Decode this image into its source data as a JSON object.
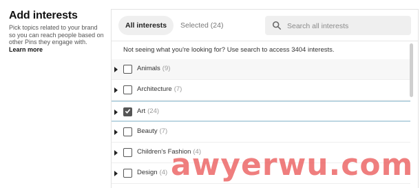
{
  "intro": {
    "title": "Add interests",
    "description": "Pick topics related to your brand so you can reach people based on other Pins they engage with.",
    "link": "Learn more"
  },
  "tabs": {
    "all": "All interests",
    "selected": "Selected (24)"
  },
  "search": {
    "placeholder": "Search all interests",
    "value": ""
  },
  "note": "Not seeing what you're looking for? Use search to access 3404 interests.",
  "interests": [
    {
      "label": "Animals",
      "count": "(9)",
      "checked": false
    },
    {
      "label": "Architecture",
      "count": "(7)",
      "checked": false
    },
    {
      "label": "Art",
      "count": "(24)",
      "checked": true
    },
    {
      "label": "Beauty",
      "count": "(7)",
      "checked": false
    },
    {
      "label": "Children's Fashion",
      "count": "(4)",
      "checked": false
    },
    {
      "label": "Design",
      "count": "(4)",
      "checked": false
    }
  ],
  "watermark": "awyerwu.com",
  "colors": {
    "selected_row_border": "#bcd6e2",
    "checkbox_checked": "#555555",
    "watermark": "#eb5a5a"
  }
}
